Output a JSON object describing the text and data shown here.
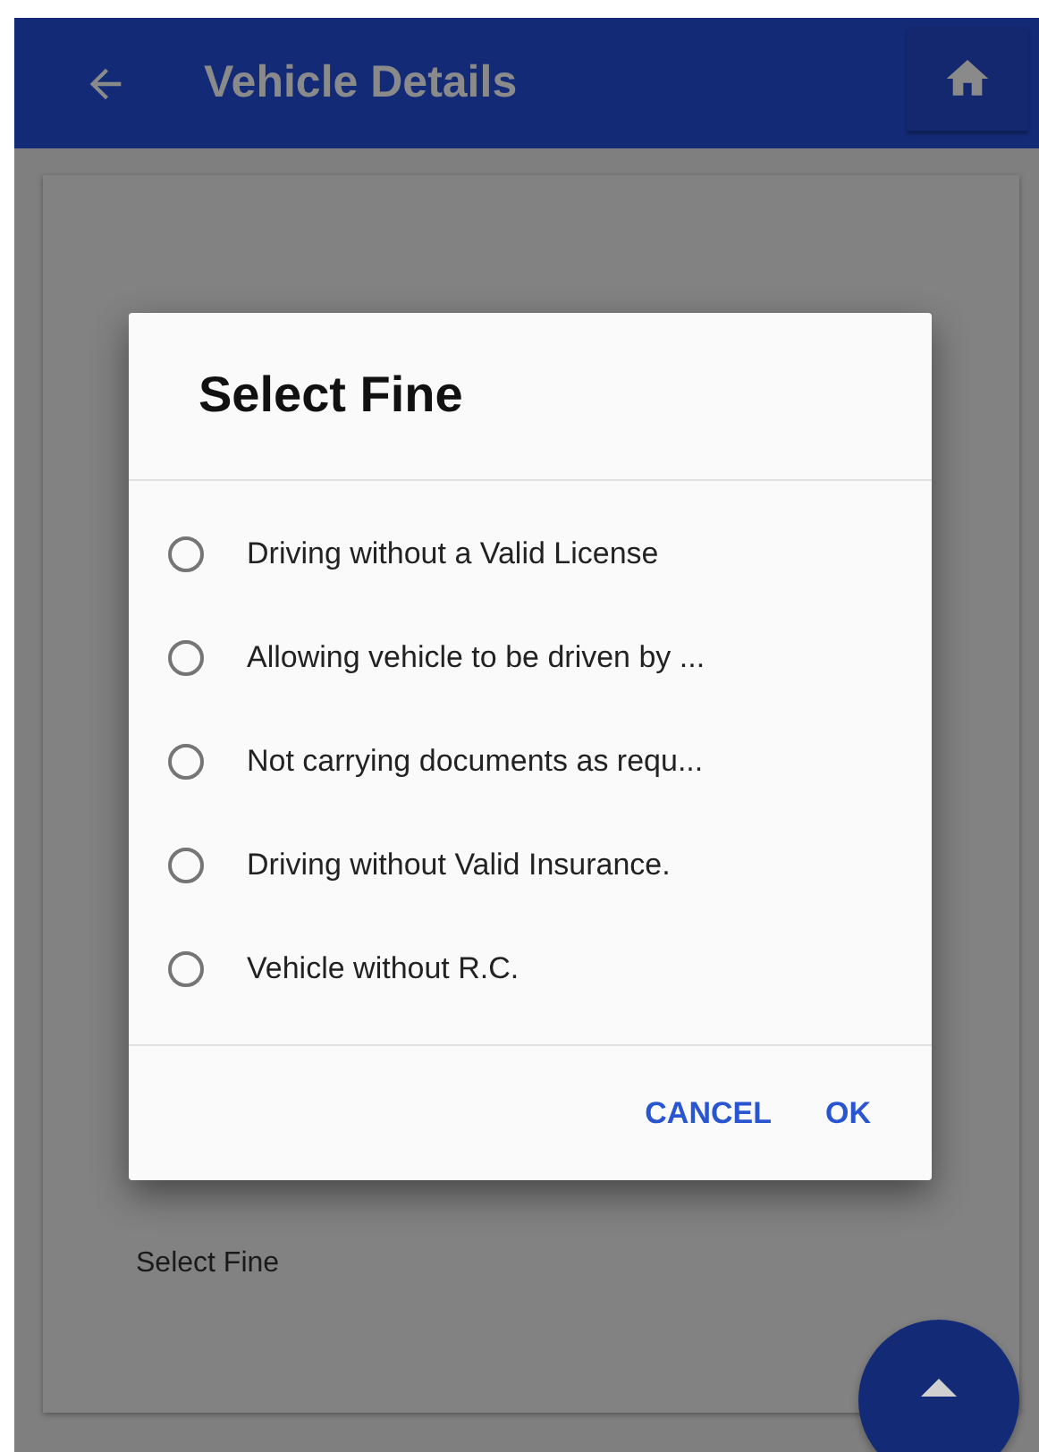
{
  "app_bar": {
    "title": "Vehicle Details"
  },
  "card": {
    "field_label": "Select Fine"
  },
  "dialog": {
    "title": "Select Fine",
    "options": [
      {
        "label": "Driving without a Valid License",
        "selected": false
      },
      {
        "label": "Allowing vehicle to be driven by ...",
        "selected": false
      },
      {
        "label": "Not carrying documents as requ...",
        "selected": false
      },
      {
        "label": "Driving without Valid Insurance.",
        "selected": false
      },
      {
        "label": "Vehicle without R.C.",
        "selected": false
      }
    ],
    "buttons": [
      "CANCEL",
      "OK"
    ]
  }
}
